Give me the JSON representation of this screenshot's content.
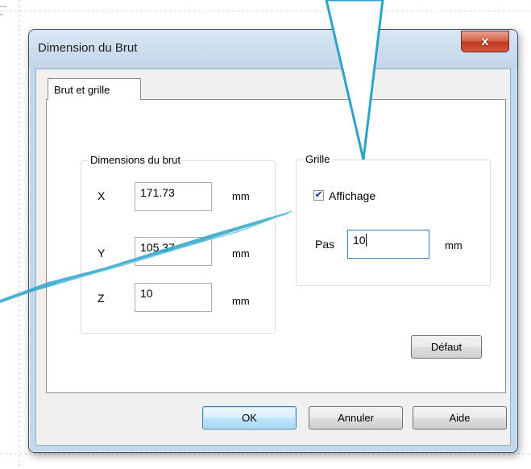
{
  "dialog": {
    "title": "Dimension du Brut",
    "close_label": "x"
  },
  "tabs": [
    {
      "label": "Brut et grille",
      "selected": true
    }
  ],
  "dimensions_group": {
    "legend": "Dimensions du brut",
    "rows": [
      {
        "label": "X",
        "value": "171.73",
        "unit": "mm"
      },
      {
        "label": "Y",
        "value": "105.37",
        "unit": "mm"
      },
      {
        "label": "Z",
        "value": "10",
        "unit": "mm"
      }
    ]
  },
  "grid_group": {
    "legend": "Grille",
    "show_grid_label": "Affichage",
    "show_grid_checked": true,
    "step_label": "Pas",
    "step_value": "10",
    "step_unit": "mm"
  },
  "buttons": {
    "default_label": "Défaut",
    "ok_label": "OK",
    "cancel_label": "Annuler",
    "help_label": "Aide"
  },
  "colors": {
    "annotation_stroke": "#2ea3c9"
  }
}
